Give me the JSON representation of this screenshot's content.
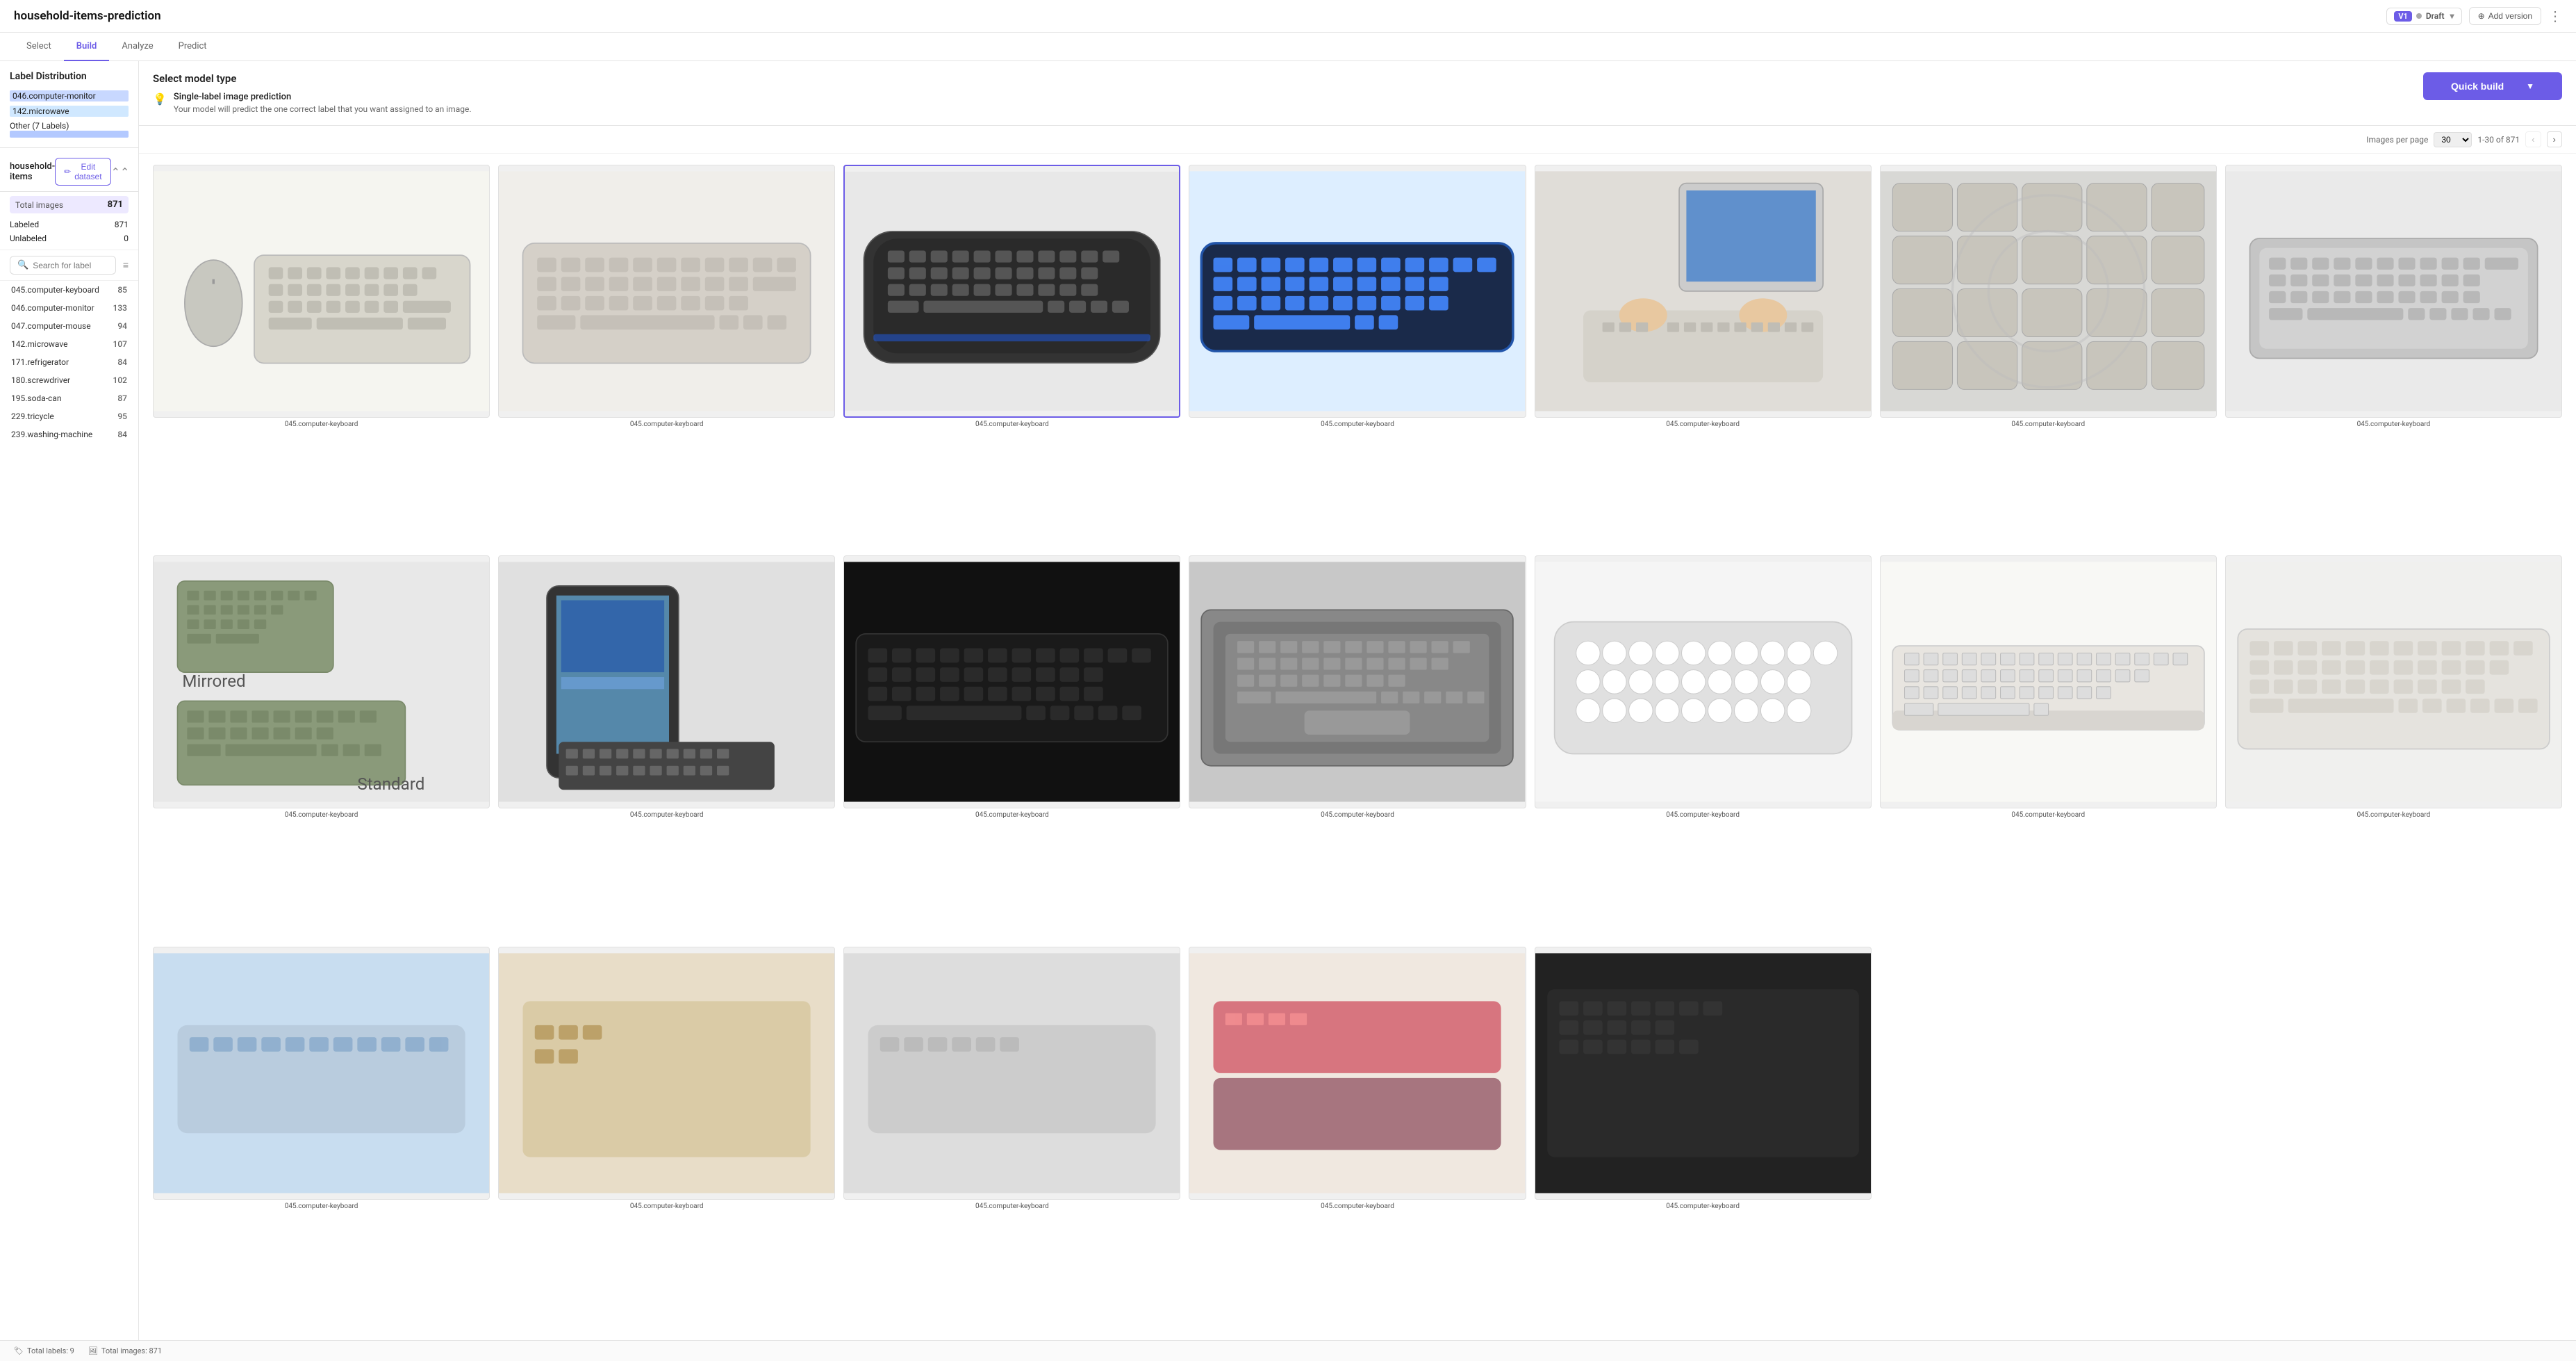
{
  "app": {
    "title": "household-items-prediction",
    "version": "V1",
    "version_status": "Draft",
    "add_version_label": "Add version",
    "more_icon": "⋮"
  },
  "nav": {
    "tabs": [
      "Select",
      "Build",
      "Analyze",
      "Predict"
    ],
    "active_tab": "Build"
  },
  "label_distribution": {
    "title": "Label Distribution",
    "items": [
      {
        "name": "046.computer-monitor",
        "highlighted": true
      },
      {
        "name": "142.microwave",
        "highlighted2": true
      },
      {
        "name": "Other (7 Labels)",
        "bar": true
      }
    ]
  },
  "model_type": {
    "title": "Select model type",
    "option_label": "Single-label image prediction",
    "option_desc": "Your model will predict the one correct label that you want assigned to an image."
  },
  "quick_build": {
    "label": "Quick build",
    "caret": "▼"
  },
  "dataset": {
    "name": "household-items",
    "edit_label": "Edit dataset"
  },
  "stats": {
    "total_images_label": "Total images",
    "total_images_value": "871",
    "labeled_label": "Labeled",
    "labeled_value": "871",
    "unlabeled_label": "Unlabeled",
    "unlabeled_value": "0"
  },
  "search": {
    "placeholder": "Search for label"
  },
  "labels": [
    {
      "name": "045.computer-keyboard",
      "count": "85"
    },
    {
      "name": "046.computer-monitor",
      "count": "133"
    },
    {
      "name": "047.computer-mouse",
      "count": "94"
    },
    {
      "name": "142.microwave",
      "count": "107"
    },
    {
      "name": "171.refrigerator",
      "count": "84"
    },
    {
      "name": "180.screwdriver",
      "count": "102"
    },
    {
      "name": "195.soda-can",
      "count": "87"
    },
    {
      "name": "229.tricycle",
      "count": "95"
    },
    {
      "name": "239.washing-machine",
      "count": "84"
    }
  ],
  "pagination": {
    "label": "Images per page",
    "per_page": "30",
    "range": "1-30 of 871",
    "prev_disabled": true,
    "next_disabled": false
  },
  "images": [
    {
      "label": "045.computer-keyboard",
      "type": "beige-keyboard",
      "selected": false
    },
    {
      "label": "045.computer-keyboard",
      "type": "beige-keyboard-2",
      "selected": false
    },
    {
      "label": "045.computer-keyboard",
      "type": "dark-curved",
      "selected": true
    },
    {
      "label": "045.computer-keyboard",
      "type": "blue-lit",
      "selected": false
    },
    {
      "label": "045.computer-keyboard",
      "type": "person-typing",
      "selected": false
    },
    {
      "label": "045.computer-keyboard",
      "type": "closeup-keys",
      "selected": false
    },
    {
      "label": "045.computer-keyboard",
      "type": "compact-silver",
      "selected": false
    },
    {
      "label": "045.computer-keyboard",
      "type": "mirrored-standard",
      "selected": false
    },
    {
      "label": "045.computer-keyboard",
      "type": "tablet-keyboard",
      "selected": false
    },
    {
      "label": "045.computer-keyboard",
      "type": "dark-flat",
      "selected": false
    },
    {
      "label": "045.computer-keyboard",
      "type": "laptop-keyboard",
      "selected": false
    },
    {
      "label": "045.computer-keyboard",
      "type": "round-keys",
      "selected": false
    },
    {
      "label": "045.computer-keyboard",
      "type": "white-side",
      "selected": false
    },
    {
      "label": "045.computer-keyboard",
      "type": "white-standard",
      "selected": false
    }
  ],
  "bottom_bar": {
    "total_labels_label": "Total labels: 9",
    "total_images_label": "Total images: 871"
  }
}
